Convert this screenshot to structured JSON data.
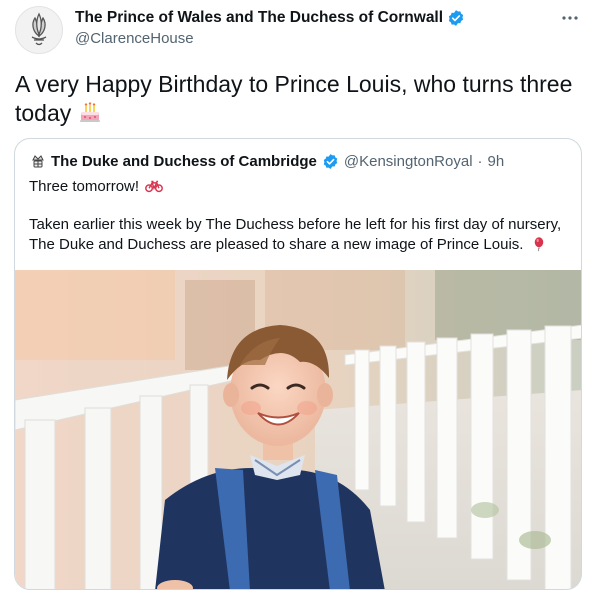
{
  "tweet": {
    "display_name": "The Prince of Wales and The Duchess of Cornwall",
    "handle": "@ClarenceHouse",
    "text": "A very Happy Birthday to Prince Louis, who turns three today",
    "emoji": "birthday-cake",
    "more_icon": "more-horizontal-icon",
    "avatar_icon": "prince-of-wales-feathers-icon"
  },
  "quote": {
    "display_name": "The Duke and Duchess of Cambridge",
    "handle": "@KensingtonRoyal",
    "separator": "·",
    "time": "9h",
    "line1": "Three tomorrow!",
    "line1_emoji": "bicycle",
    "line2": "Taken earlier this week by The Duchess before he left for his first day of nursery, The Duke and Duchess are pleased to share a new image of Prince Louis.",
    "line2_emoji": "balloon",
    "photo": "Young boy smiling, wearing a navy sweater and blue backpack, in front of a white fence"
  },
  "colors": {
    "text": "#0f1419",
    "secondary": "#536471",
    "verified": "#1d9bf0",
    "border": "#cfd9de"
  }
}
